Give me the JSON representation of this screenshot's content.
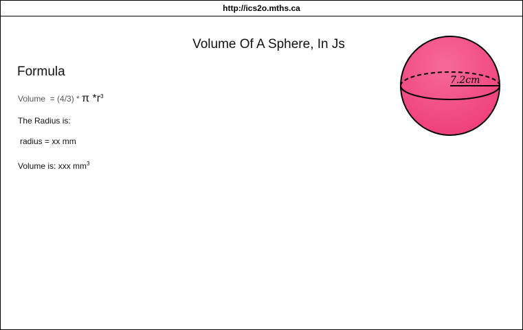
{
  "browser": {
    "url": "http://ics2o.mths.ca"
  },
  "page": {
    "title": "Volume Of A Sphere, In Js",
    "formula_heading": "Formula",
    "formula": {
      "prefix": "Volume  = (4/3) * ",
      "pi": "π",
      "times_r": " *r",
      "exponent": "3"
    },
    "radius_label": "The Radius is:",
    "radius_line": {
      "text": "radius = xx mm"
    },
    "volume_line": {
      "text": "Volume is: xxx mm",
      "exponent": "3"
    }
  },
  "sphere_image": {
    "label": "7.2cm",
    "fill_color": "#f03e7a",
    "outline_color": "#000000"
  }
}
